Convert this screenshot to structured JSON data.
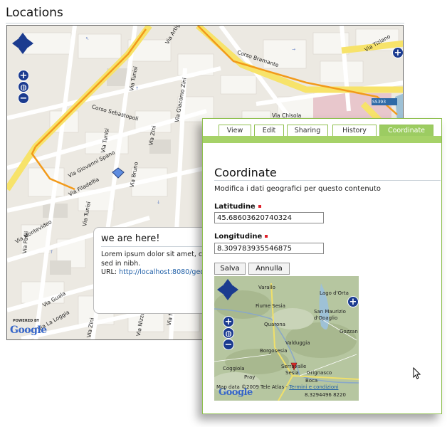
{
  "section_title": "Locations",
  "street_map": {
    "street_labels": [
      "Via Tunisi",
      "Via Tunisi",
      "Corso Sebastopoli",
      "Via Giovanni Spano",
      "Via Filadelfia",
      "Via Montevideo",
      "Via Tunisi",
      "Via Paoli",
      "Via Guala",
      "Via La Loggia",
      "Via Nizza",
      "Corso Bramante",
      "Via Chisola",
      "Via Tiziano",
      "Via Giacomo Zini",
      "Via Bruno",
      "Via Zini",
      "Via Nizza",
      "Via Artigo",
      "Via Zini"
    ],
    "road_sign": "SS393",
    "google_powered": "POWERED BY",
    "google_logo": "Google",
    "info_window": {
      "title": "we are here!",
      "body": "Lorem ipsum dolor sit amet, co sed in nibh.",
      "url_label": "URL:",
      "url": "http://localhost:8080/geo"
    }
  },
  "edit_panel": {
    "tabs": [
      {
        "label": "View",
        "active": false
      },
      {
        "label": "Edit",
        "active": false
      },
      {
        "label": "Sharing",
        "active": false
      },
      {
        "label": "History",
        "active": false
      },
      {
        "label": "Coordinate",
        "active": true
      }
    ],
    "heading": "Coordinate",
    "description": "Modifica i dati geografici per questo contenuto",
    "latitude": {
      "label": "Latitudine",
      "value": "45.68603620740324"
    },
    "longitude": {
      "label": "Longitudine",
      "value": "8.309783935546875"
    },
    "save_label": "Salva",
    "cancel_label": "Annulla",
    "terrain_map": {
      "places": [
        "Varallo",
        "Lago d'Orta",
        "Fiume Sesia",
        "San Maurizio d'Opaglio",
        "Quarona",
        "Gozzan",
        "Valduggia",
        "Borgosesia",
        "Coggiola",
        "Serravalle",
        "Sesia",
        "Grignasco",
        "Pray",
        "Boca"
      ],
      "map_data": "Map data ©2009 Tele Atlas -",
      "terms": "Termini e condizioni",
      "scale": "8.3294496 8220",
      "google_logo": "Google"
    }
  },
  "colors": {
    "accent_green": "#9ccc62",
    "border_green": "#8fc04f",
    "map_control": "#1b3b8f",
    "route_orange": "#f29a1a"
  }
}
